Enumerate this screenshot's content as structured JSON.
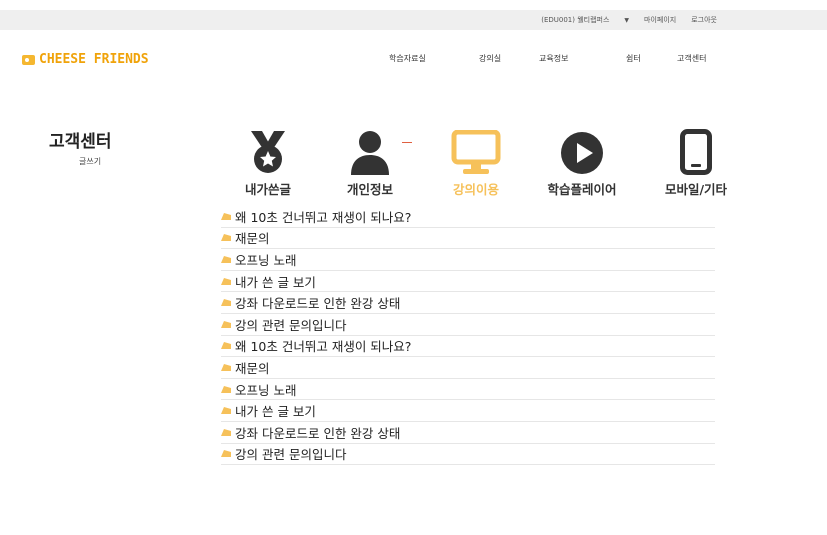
{
  "topbar": {
    "account_label": "(EDU001) 웰티랩퍼스",
    "mypage_label": "마이페이지",
    "logout_label": "로그아웃"
  },
  "logo": {
    "text": "CHEESE FRIENDS"
  },
  "gnb": {
    "items": [
      "학습자료실",
      "강의실",
      "교육정보",
      "쉼터",
      "고객센터"
    ]
  },
  "side": {
    "title": "고객센터",
    "sub": "글쓰기"
  },
  "categories": [
    {
      "label": "내가쓴글",
      "icon": "medal-icon",
      "active": false
    },
    {
      "label": "개인정보",
      "icon": "user-icon",
      "active": false
    },
    {
      "label": "강의이용",
      "icon": "monitor-icon",
      "active": true
    },
    {
      "label": "학습플레이어",
      "icon": "play-icon",
      "active": false
    },
    {
      "label": "모바일/기타",
      "icon": "mobile-icon",
      "active": false
    }
  ],
  "colors": {
    "accent": "#f6c15a",
    "logo": "#f0a30a"
  },
  "posts": [
    "왜 10초 건너뛰고 재생이 되나요?",
    "재문의",
    "오프닝 노래",
    "내가 쓴 글 보기",
    "강좌 다운로드로 인한 완강 상태",
    "강의 관련 문의입니다",
    "왜 10초 건너뛰고 재생이 되나요?",
    "재문의",
    "오프닝 노래",
    "내가 쓴 글 보기",
    "강좌 다운로드로 인한 완강 상태",
    "강의 관련 문의입니다"
  ]
}
